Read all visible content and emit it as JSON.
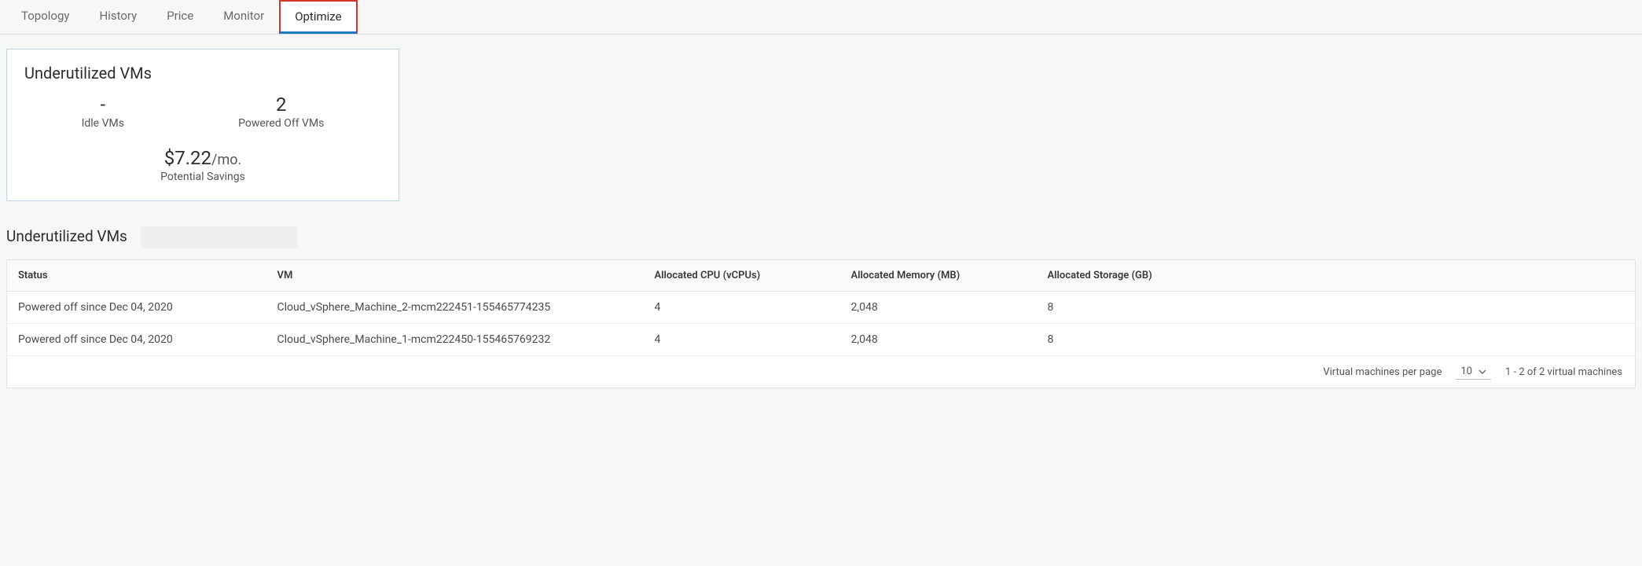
{
  "tabs": [
    {
      "label": "Topology",
      "active": false
    },
    {
      "label": "History",
      "active": false
    },
    {
      "label": "Price",
      "active": false
    },
    {
      "label": "Monitor",
      "active": false
    },
    {
      "label": "Optimize",
      "active": true
    }
  ],
  "card": {
    "title": "Underutilized VMs",
    "idle_value": "-",
    "idle_label": "Idle VMs",
    "poweredoff_value": "2",
    "poweredoff_label": "Powered Off VMs",
    "savings_value": "$7.22",
    "savings_unit": "/mo.",
    "savings_label": "Potential Savings"
  },
  "section_title": "Underutilized VMs",
  "table": {
    "headers": {
      "status": "Status",
      "vm": "VM",
      "cpu": "Allocated CPU (vCPUs)",
      "mem": "Allocated Memory (MB)",
      "storage": "Allocated Storage (GB)"
    },
    "rows": [
      {
        "status": "Powered off since Dec 04, 2020",
        "vm": "Cloud_vSphere_Machine_2-mcm222451-155465774235",
        "cpu": "4",
        "mem": "2,048",
        "storage": "8"
      },
      {
        "status": "Powered off since Dec 04, 2020",
        "vm": "Cloud_vSphere_Machine_1-mcm222450-155465769232",
        "cpu": "4",
        "mem": "2,048",
        "storage": "8"
      }
    ]
  },
  "pager": {
    "per_page_label": "Virtual machines per page",
    "per_page_value": "10",
    "range_text": "1 - 2 of 2 virtual machines"
  }
}
